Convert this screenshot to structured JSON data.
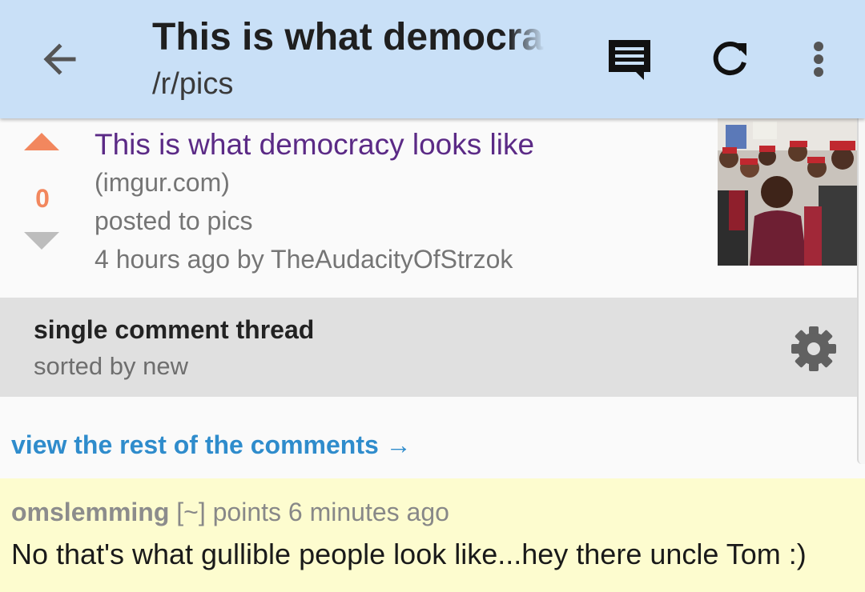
{
  "appbar": {
    "title": "This is what democracy looks like",
    "subtitle": "/r/pics",
    "icons": [
      "back-arrow-icon",
      "comments-icon",
      "refresh-icon",
      "more-vert-icon"
    ],
    "background": "#c9e0f7"
  },
  "post": {
    "score": "0",
    "title": "This is what democracy looks like",
    "domain": "(imgur.com)",
    "subreddit_line": "posted to pics",
    "meta_line": "4 hours ago by TheAudacityOfStrzok",
    "colors": {
      "upvote": "#f2875e",
      "downvote": "#bdbdbd",
      "title": "#5b2a86"
    }
  },
  "thread": {
    "title": "single comment thread",
    "sort": "sorted by new"
  },
  "view_rest_link": "view the rest of the comments →",
  "comment": {
    "author": "omslemming",
    "points": "[~] points",
    "age": "6 minutes ago",
    "body": "No that's what gullible people look like...hey there uncle Tom :)",
    "highlight": "#fdfccf"
  }
}
